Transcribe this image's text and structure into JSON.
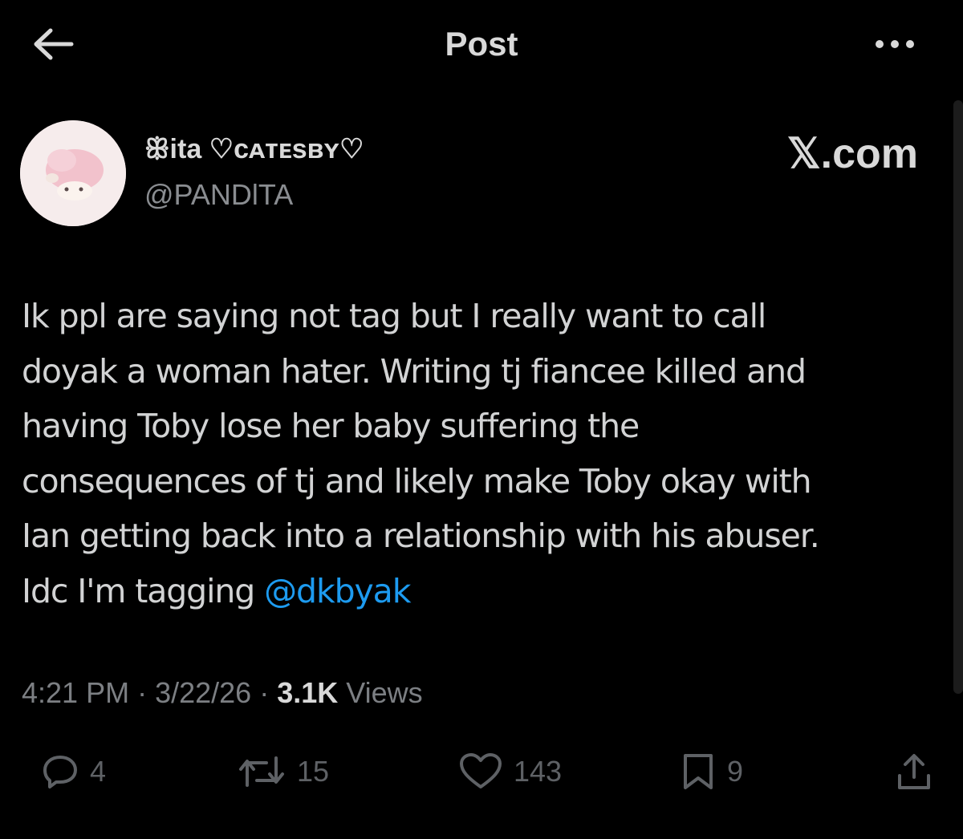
{
  "header": {
    "title": "Post",
    "back_icon": "arrow-left-icon",
    "more_icon": "more-dots-icon"
  },
  "author": {
    "display_name": "ꕥita ♡ᴄᴀᴛᴇsʙʏ♡",
    "handle": "@PANDlTA"
  },
  "site_label": "𝕏.com",
  "post": {
    "lines": [
      "Ik ppl are saying not tag but I really want to call",
      "doyak a woman hater. Writing tj fiancee killed and",
      "having Toby lose her baby suffering the",
      "consequences of tj and likely make Toby okay with",
      "Ian getting back into a relationship with his abuser."
    ],
    "last_line_prefix": "Idc I'm tagging ",
    "mention": "@dkbyak"
  },
  "meta": {
    "time": "4:21 PM",
    "sep1": " · ",
    "date": "3/22/26",
    "sep2": " · ",
    "views_count": "3.1K",
    "views_label": " Views"
  },
  "actions": {
    "replies": "4",
    "reposts": "15",
    "likes": "143",
    "bookmarks": "9"
  },
  "colors": {
    "background": "#000000",
    "text": "#d2d3d4",
    "muted": "#7c7f83",
    "link": "#1d9bf0"
  }
}
